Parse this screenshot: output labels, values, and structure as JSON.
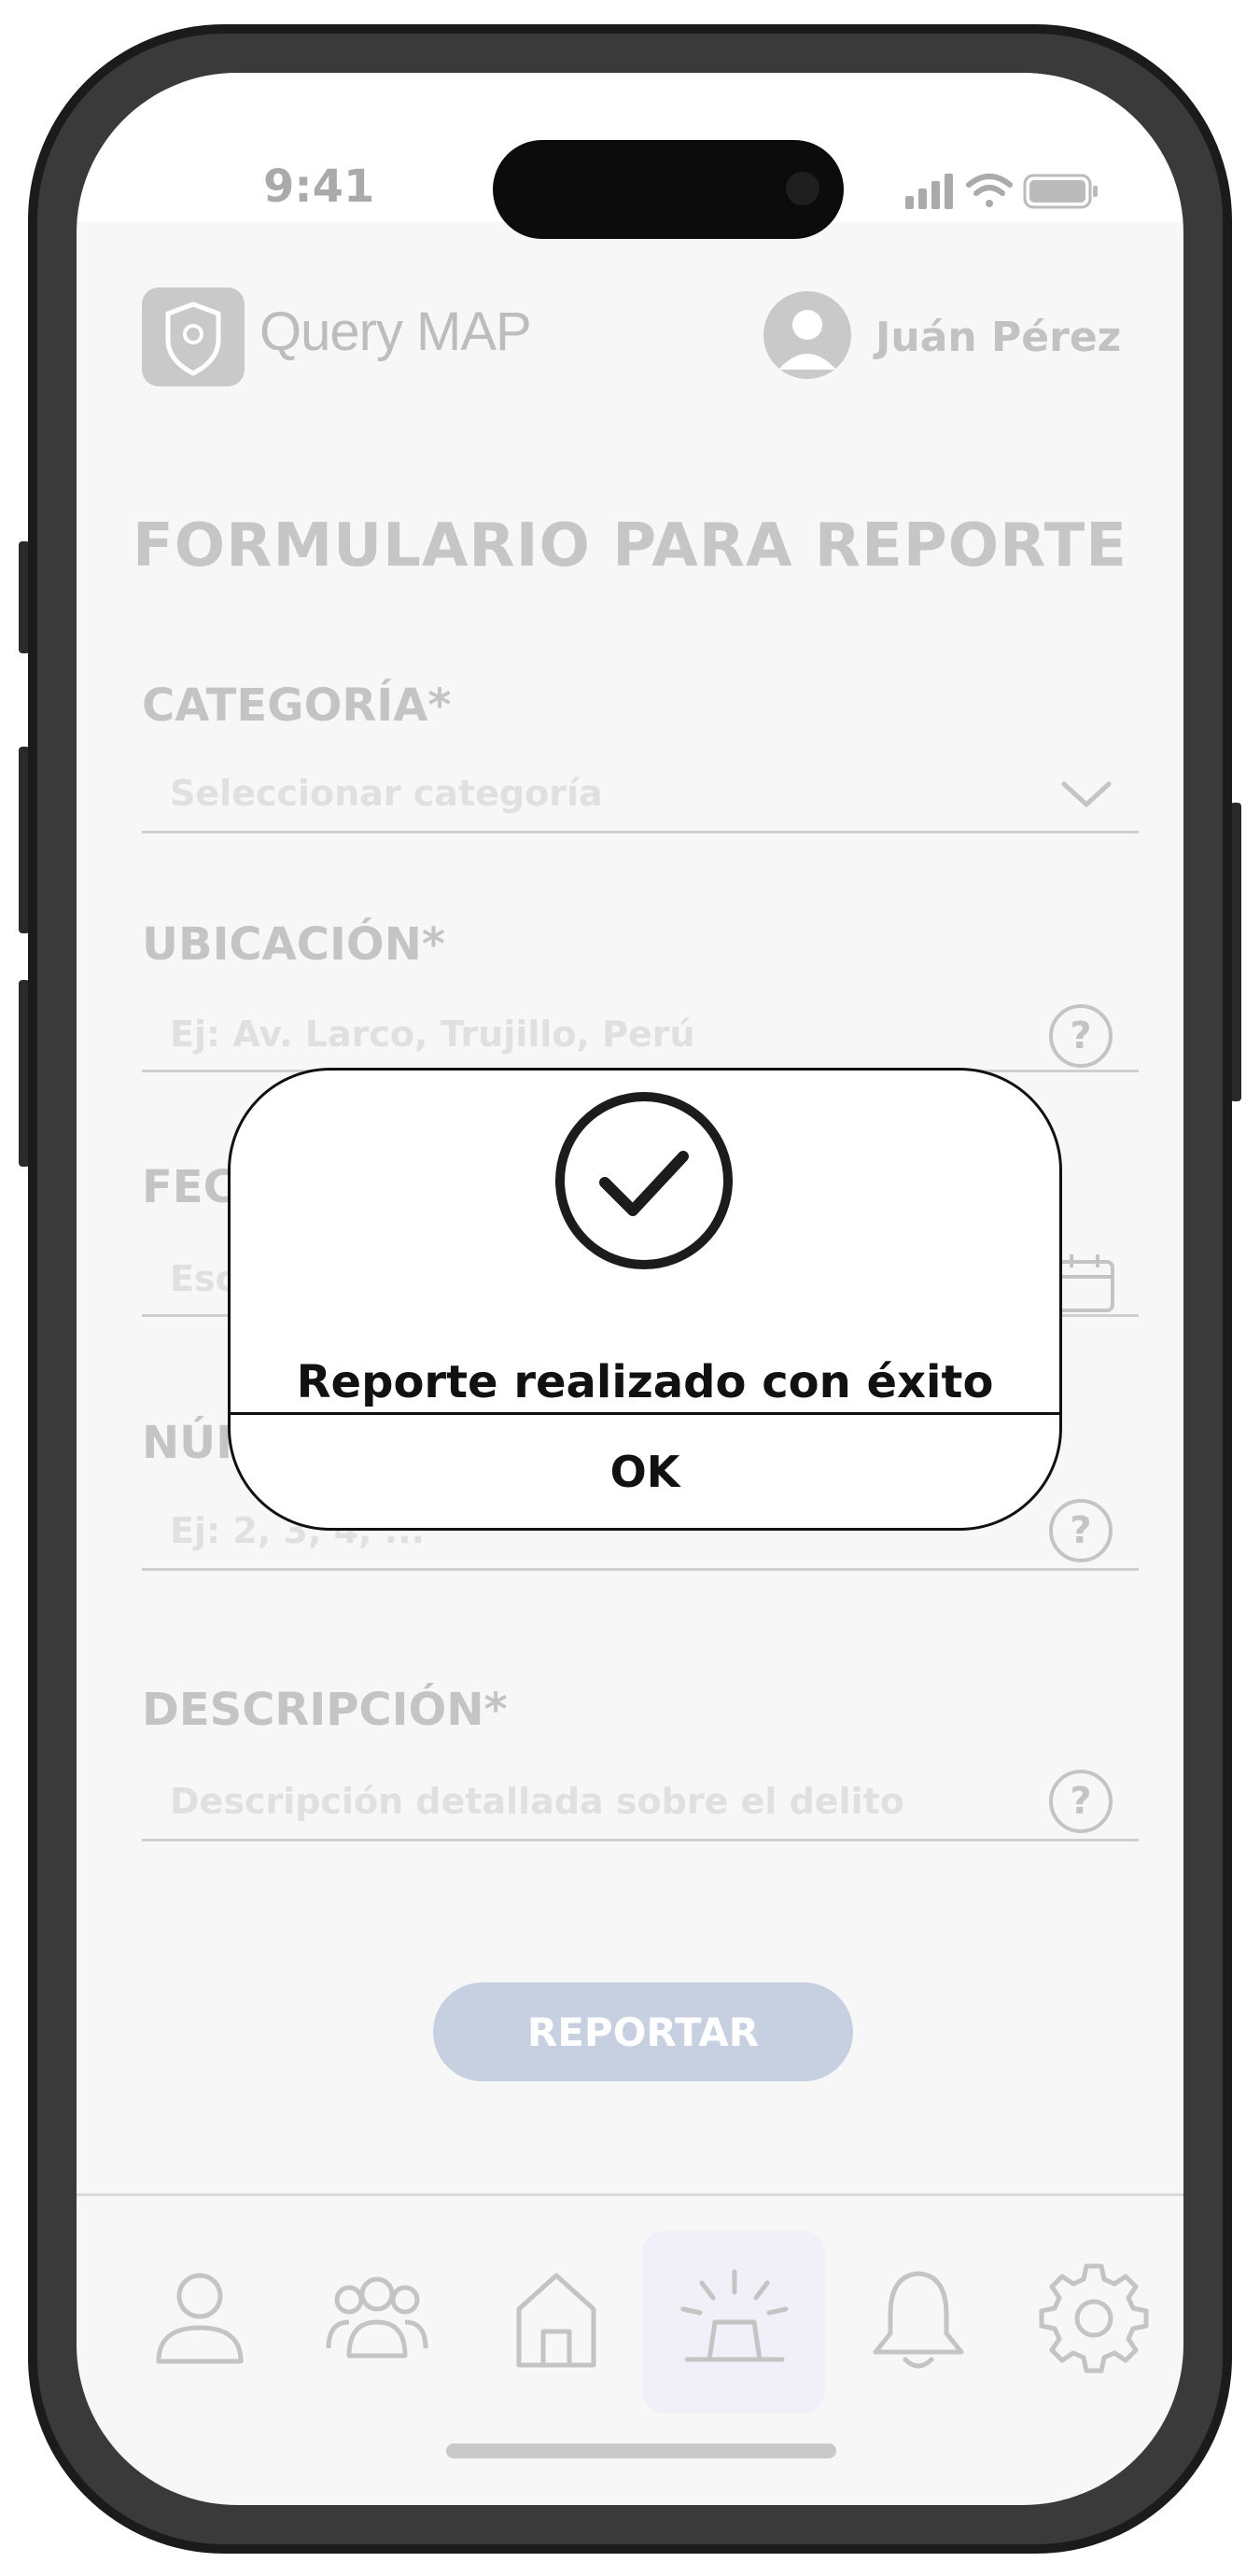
{
  "status_bar": {
    "time": "9:41"
  },
  "header": {
    "app_name": "Query MAP",
    "user_name": "Juán Pérez"
  },
  "form": {
    "title": "FORMULARIO PARA REPORTE",
    "fields": [
      {
        "label": "CATEGORÍA*",
        "placeholder": "Seleccionar categoría"
      },
      {
        "label": "UBICACIÓN*",
        "placeholder": "Ej: Av. Larco, Trujillo, Perú"
      },
      {
        "label": "FEC",
        "placeholder": "Esc"
      },
      {
        "label": "NÚI",
        "placeholder": "Ej: 2, 3, 4, ..."
      },
      {
        "label": "DESCRIPCIÓN*",
        "placeholder": "Descripción detallada sobre el delito"
      }
    ],
    "submit_label": "REPORTAR"
  },
  "bottom_nav": {
    "items": [
      {
        "icon": "user-icon"
      },
      {
        "icon": "group-icon"
      },
      {
        "icon": "home-icon"
      },
      {
        "icon": "alarm-siren-icon",
        "active": true
      },
      {
        "icon": "bell-icon"
      },
      {
        "icon": "gear-icon"
      }
    ]
  },
  "modal": {
    "message": "Reporte realizado con éxito",
    "ok_label": "OK"
  },
  "colors": {
    "screen_bg": "#f7f7f7",
    "button_bg": "#c6d0e1",
    "nav_active_bg": "#f1eff8",
    "modal_border": "#111111"
  }
}
